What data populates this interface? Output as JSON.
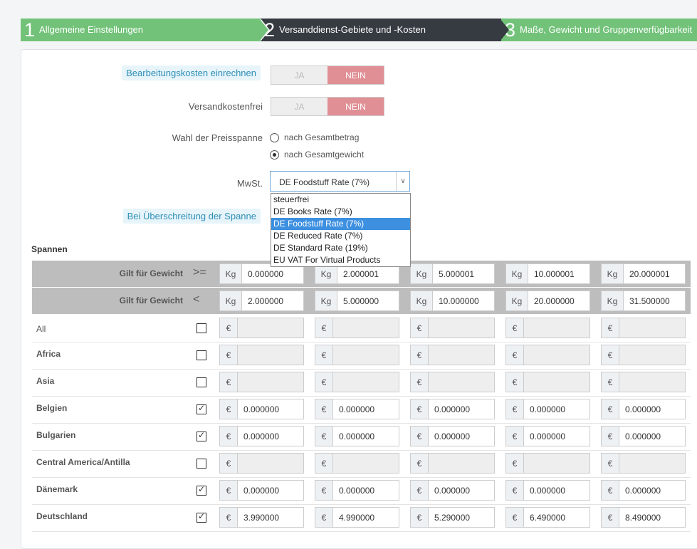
{
  "wizard": {
    "steps": [
      {
        "num": "1",
        "label": "Allgemeine Einstellungen"
      },
      {
        "num": "2",
        "label": "Versanddienst-Gebiete und -Kosten"
      },
      {
        "num": "3",
        "label": "Maße, Gewicht und Gruppenverfügbarkeit"
      }
    ]
  },
  "form": {
    "handling_label": "Bearbeitungskosten einrechnen",
    "free_label": "Versandkostenfrei",
    "yes": "JA",
    "no": "NEIN",
    "billing_label": "Wahl der Preisspanne",
    "billing_options": [
      "nach Gesamtbetrag",
      "nach Gesamtgewicht"
    ],
    "tax_label": "MwSt.",
    "tax_value": "DE Foodstuff Rate (7%)",
    "tax_options": [
      "steuerfrei",
      "DE Books Rate (7%)",
      "DE Foodstuff Rate (7%)",
      "DE Reduced Rate (7%)",
      "DE Standard Rate (19%)",
      "EU VAT For Virtual Products"
    ],
    "out_of_range_label": "Bei Überschreitung der Spanne"
  },
  "ranges": {
    "title": "Spannen",
    "from_label": "Gilt für Gewicht",
    "from_op": ">=",
    "to_label": "Gilt für Gewicht",
    "to_op": "<",
    "unit": "Kg",
    "currency": "€",
    "from": [
      "0.000000",
      "2.000001",
      "5.000001",
      "10.000001",
      "20.000001"
    ],
    "to": [
      "2.000000",
      "5.000000",
      "10.000000",
      "20.000000",
      "31.500000"
    ],
    "zones": [
      {
        "name": "All",
        "checked": false,
        "prices": [
          "",
          "",
          "",
          "",
          ""
        ]
      },
      {
        "name": "Africa",
        "checked": false,
        "prices": [
          "",
          "",
          "",
          "",
          ""
        ]
      },
      {
        "name": "Asia",
        "checked": false,
        "prices": [
          "",
          "",
          "",
          "",
          ""
        ]
      },
      {
        "name": "Belgien",
        "checked": true,
        "prices": [
          "0.000000",
          "0.000000",
          "0.000000",
          "0.000000",
          "0.000000"
        ]
      },
      {
        "name": "Bulgarien",
        "checked": true,
        "prices": [
          "0.000000",
          "0.000000",
          "0.000000",
          "0.000000",
          "0.000000"
        ]
      },
      {
        "name": "Central America/Antilla",
        "checked": false,
        "prices": [
          "",
          "",
          "",
          "",
          ""
        ]
      },
      {
        "name": "Dänemark",
        "checked": true,
        "prices": [
          "0.000000",
          "0.000000",
          "0.000000",
          "0.000000",
          "0.000000"
        ]
      },
      {
        "name": "Deutschland",
        "checked": true,
        "prices": [
          "3.990000",
          "4.990000",
          "5.290000",
          "6.490000",
          "8.490000"
        ]
      }
    ]
  }
}
